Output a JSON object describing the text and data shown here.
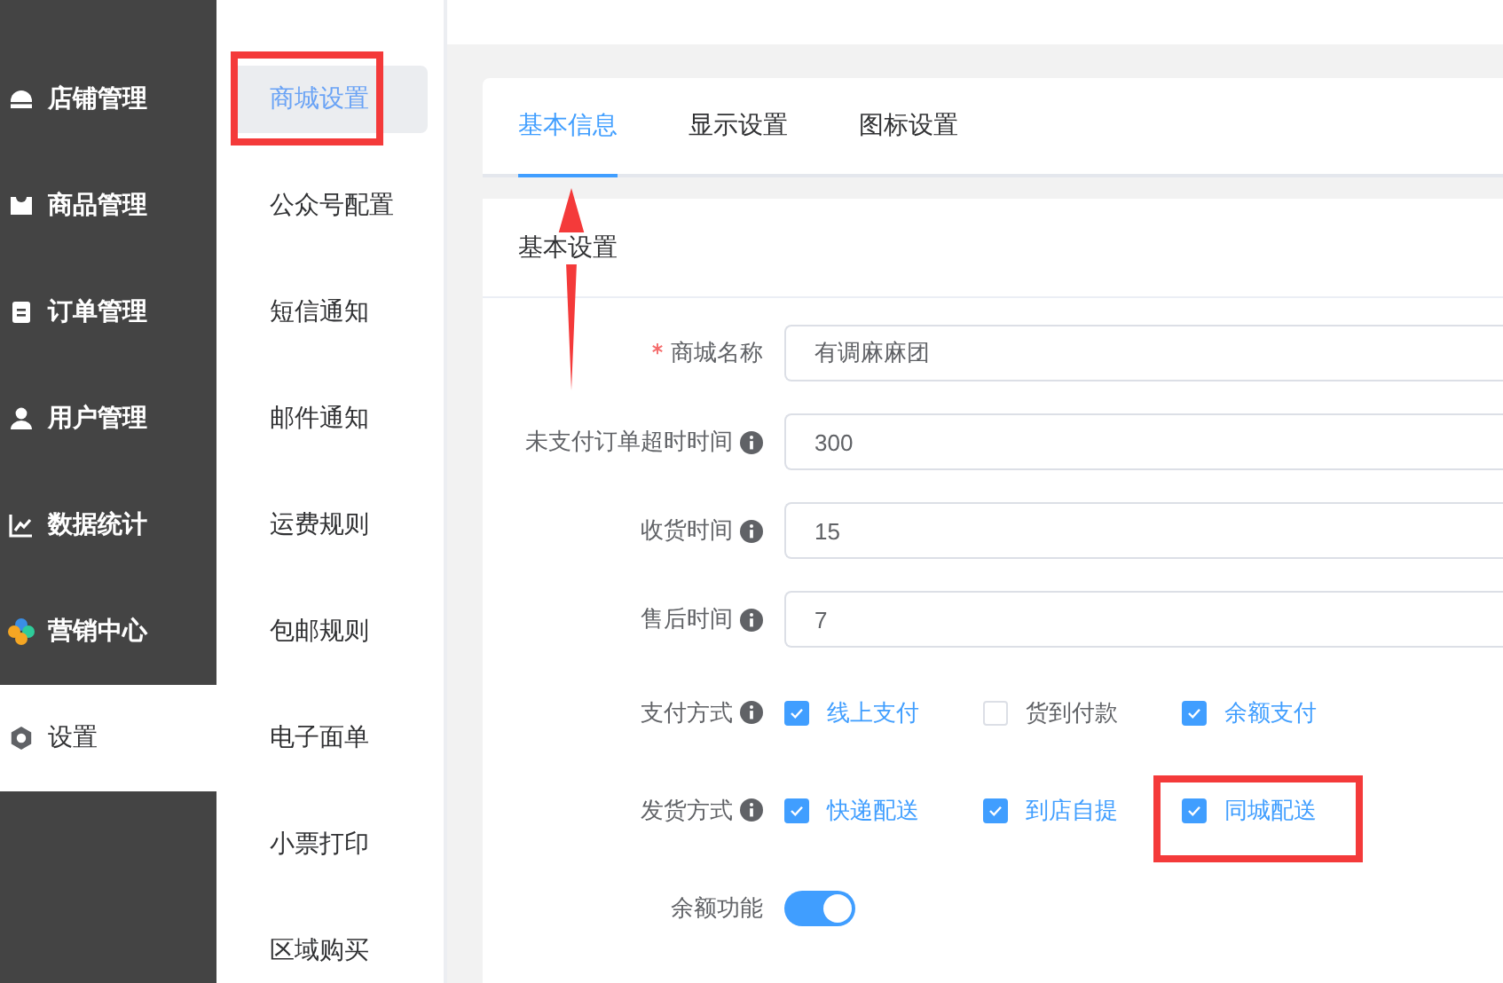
{
  "sidebar": {
    "items": [
      {
        "label": "店铺管理",
        "selected": false
      },
      {
        "label": "商品管理",
        "selected": false
      },
      {
        "label": "订单管理",
        "selected": false
      },
      {
        "label": "用户管理",
        "selected": false
      },
      {
        "label": "数据统计",
        "selected": false
      },
      {
        "label": "营销中心",
        "selected": false
      },
      {
        "label": "设置",
        "selected": true
      }
    ]
  },
  "submenu": {
    "items": [
      {
        "label": "商城设置",
        "selected": true
      },
      {
        "label": "公众号配置",
        "selected": false
      },
      {
        "label": "短信通知",
        "selected": false
      },
      {
        "label": "邮件通知",
        "selected": false
      },
      {
        "label": "运费规则",
        "selected": false
      },
      {
        "label": "包邮规则",
        "selected": false
      },
      {
        "label": "电子面单",
        "selected": false
      },
      {
        "label": "小票打印",
        "selected": false
      },
      {
        "label": "区域购买",
        "selected": false
      }
    ]
  },
  "tabs": [
    {
      "label": "基本信息",
      "selected": true
    },
    {
      "label": "显示设置",
      "selected": false
    },
    {
      "label": "图标设置",
      "selected": false
    }
  ],
  "section": {
    "title": "基本设置",
    "fields": [
      {
        "kind": "input",
        "label": "商城名称",
        "required": true,
        "info": false,
        "value": "有调麻麻团"
      },
      {
        "kind": "input",
        "label": "未支付订单超时时间",
        "required": false,
        "info": true,
        "value": "300"
      },
      {
        "kind": "input",
        "label": "收货时间",
        "required": false,
        "info": true,
        "value": "15"
      },
      {
        "kind": "input",
        "label": "售后时间",
        "required": false,
        "info": true,
        "value": "7"
      },
      {
        "kind": "checkboxes",
        "label": "支付方式",
        "required": false,
        "info": true,
        "options": [
          {
            "label": "线上支付",
            "checked": true
          },
          {
            "label": "货到付款",
            "checked": false
          },
          {
            "label": "余额支付",
            "checked": true
          }
        ]
      },
      {
        "kind": "checkboxes",
        "label": "发货方式",
        "required": false,
        "info": true,
        "options": [
          {
            "label": "快递配送",
            "checked": true
          },
          {
            "label": "到店自提",
            "checked": true
          },
          {
            "label": "同城配送",
            "checked": true
          }
        ]
      },
      {
        "kind": "switch",
        "label": "余额功能",
        "required": false,
        "info": false,
        "on": true
      }
    ]
  }
}
